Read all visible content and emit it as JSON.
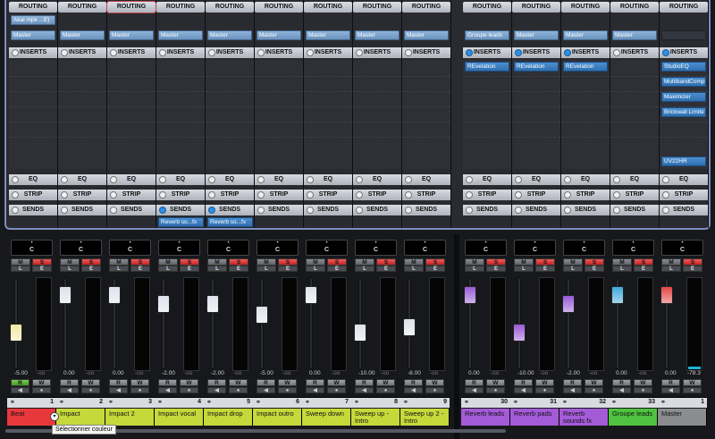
{
  "channels": [
    {
      "num": "1",
      "name": "Beat",
      "color": "#e8383b",
      "pan": "C",
      "volume": "-5.00",
      "peak": "-oo",
      "routing_input": "Akai mpk ...E)",
      "routing_output": "Master",
      "inserts": [],
      "sends": [],
      "sends_active": false,
      "inserts_active": false,
      "fader_level": 0.4,
      "cap_color": "#f2e9a3",
      "read_on": true
    },
    {
      "num": "2",
      "name": "Impact",
      "color": "#c6d83a",
      "pan": "C",
      "volume": "0.00",
      "peak": "-oo",
      "routing_input": "",
      "routing_output": "Master",
      "inserts": [],
      "sends": [],
      "sends_active": false,
      "inserts_active": false,
      "fader_level": 0.81,
      "cap_color": "#dde3ea",
      "read_on": false
    },
    {
      "num": "3",
      "name": "Impact 2",
      "color": "#c6d83a",
      "pan": "C",
      "volume": "0.00",
      "peak": "-oo",
      "routing_input": "",
      "routing_output": "Master",
      "inserts": [],
      "sends": [],
      "sends_active": false,
      "inserts_active": false,
      "fader_level": 0.81,
      "cap_color": "#dde3ea",
      "read_on": false
    },
    {
      "num": "4",
      "name": "Impact vocal",
      "color": "#c6d83a",
      "pan": "C",
      "volume": "-2.00",
      "peak": "-oo",
      "routing_input": "",
      "routing_output": "Master",
      "inserts": [],
      "sends": [
        "Reverb so...fx"
      ],
      "sends_active": true,
      "inserts_active": false,
      "fader_level": 0.72,
      "cap_color": "#dde3ea",
      "read_on": false
    },
    {
      "num": "5",
      "name": "Impact drop",
      "color": "#c6d83a",
      "pan": "C",
      "volume": "-2.00",
      "peak": "-oo",
      "routing_input": "",
      "routing_output": "Master",
      "inserts": [],
      "sends": [
        "Reverb so...fx"
      ],
      "sends_active": true,
      "inserts_active": false,
      "fader_level": 0.72,
      "cap_color": "#dde3ea",
      "read_on": false
    },
    {
      "num": "6",
      "name": "Impact outro",
      "color": "#c6d83a",
      "pan": "C",
      "volume": "-5.00",
      "peak": "-oo",
      "routing_input": "",
      "routing_output": "Master",
      "inserts": [],
      "sends": [],
      "sends_active": false,
      "inserts_active": false,
      "fader_level": 0.6,
      "cap_color": "#dde3ea",
      "read_on": false
    },
    {
      "num": "7",
      "name": "Sweep down",
      "color": "#c6d83a",
      "pan": "C",
      "volume": "0.00",
      "peak": "-oo",
      "routing_input": "",
      "routing_output": "Master",
      "inserts": [],
      "sends": [],
      "sends_active": false,
      "inserts_active": false,
      "fader_level": 0.81,
      "cap_color": "#dde3ea",
      "read_on": false
    },
    {
      "num": "8",
      "name": "Sweep up - Intro",
      "color": "#c6d83a",
      "pan": "C",
      "volume": "-10.00",
      "peak": "-oo",
      "routing_input": "",
      "routing_output": "Master",
      "inserts": [],
      "sends": [],
      "sends_active": false,
      "inserts_active": false,
      "fader_level": 0.4,
      "cap_color": "#dde3ea",
      "read_on": false
    },
    {
      "num": "9",
      "name": "Sweep up 2 - Intro",
      "color": "#c6d83a",
      "pan": "C",
      "volume": "-8.00",
      "peak": "-oo",
      "routing_input": "",
      "routing_output": "Master",
      "inserts": [],
      "sends": [],
      "sends_active": false,
      "inserts_active": false,
      "fader_level": 0.46,
      "cap_color": "#dde3ea",
      "read_on": false
    },
    {
      "num": "30",
      "name": "Reverb leads",
      "color": "#a45bd8",
      "pan": "C",
      "volume": "0.00",
      "peak": "-oo",
      "routing_input": "",
      "routing_output": "Groupe leads",
      "inserts": [
        "REvelation"
      ],
      "sends": [],
      "sends_active": false,
      "inserts_active": true,
      "fader_level": 0.81,
      "cap_color": "#9a5ad6",
      "read_on": false
    },
    {
      "num": "31",
      "name": "Reverb pads",
      "color": "#a45bd8",
      "pan": "C",
      "volume": "-10.00",
      "peak": "-oo",
      "routing_input": "",
      "routing_output": "Master",
      "inserts": [
        "REvelation"
      ],
      "sends": [],
      "sends_active": false,
      "inserts_active": true,
      "fader_level": 0.4,
      "cap_color": "#9a5ad6",
      "read_on": false
    },
    {
      "num": "32",
      "name": "Reverb sounds fx",
      "color": "#a45bd8",
      "pan": "C",
      "volume": "-2.00",
      "peak": "-oo",
      "routing_input": "",
      "routing_output": "Master",
      "inserts": [
        "REvelation"
      ],
      "sends": [],
      "sends_active": false,
      "inserts_active": true,
      "fader_level": 0.72,
      "cap_color": "#9a5ad6",
      "read_on": false
    },
    {
      "num": "33",
      "name": "Groupe leads",
      "color": "#4fc33f",
      "pan": "C",
      "volume": "0.00",
      "peak": "-oo",
      "routing_input": "",
      "routing_output": "Master",
      "inserts": [],
      "sends": [],
      "sends_active": false,
      "inserts_active": false,
      "fader_level": 0.81,
      "cap_color": "#3fa8d8",
      "read_on": false
    },
    {
      "num": "1",
      "name": "Master",
      "color": "#8a8c90",
      "pan": "C",
      "volume": "0.00",
      "peak": "-78.3",
      "routing_input": "",
      "routing_output": "",
      "inserts": [
        "StudioEQ",
        "MultibandComp",
        "Maximizer",
        "Brickwall Limite",
        "UV22HR"
      ],
      "sends": [],
      "sends_active": false,
      "inserts_active": true,
      "fader_level": 0.81,
      "cap_color": "#e24545",
      "read_on": false
    }
  ],
  "labels": {
    "routing": "ROUTING",
    "inserts": "INSERTS",
    "eq": "EQ",
    "strip": "STRIP",
    "sends": "SENDS",
    "mute": "M",
    "solo": "S",
    "read": "R",
    "write": "W"
  },
  "tooltip": "Sélectionner couleur",
  "colors": {
    "accent": "#2d8fe6",
    "solo": "#d93333",
    "read_active": "#4aab2d",
    "meter": "#1fb0d8"
  }
}
